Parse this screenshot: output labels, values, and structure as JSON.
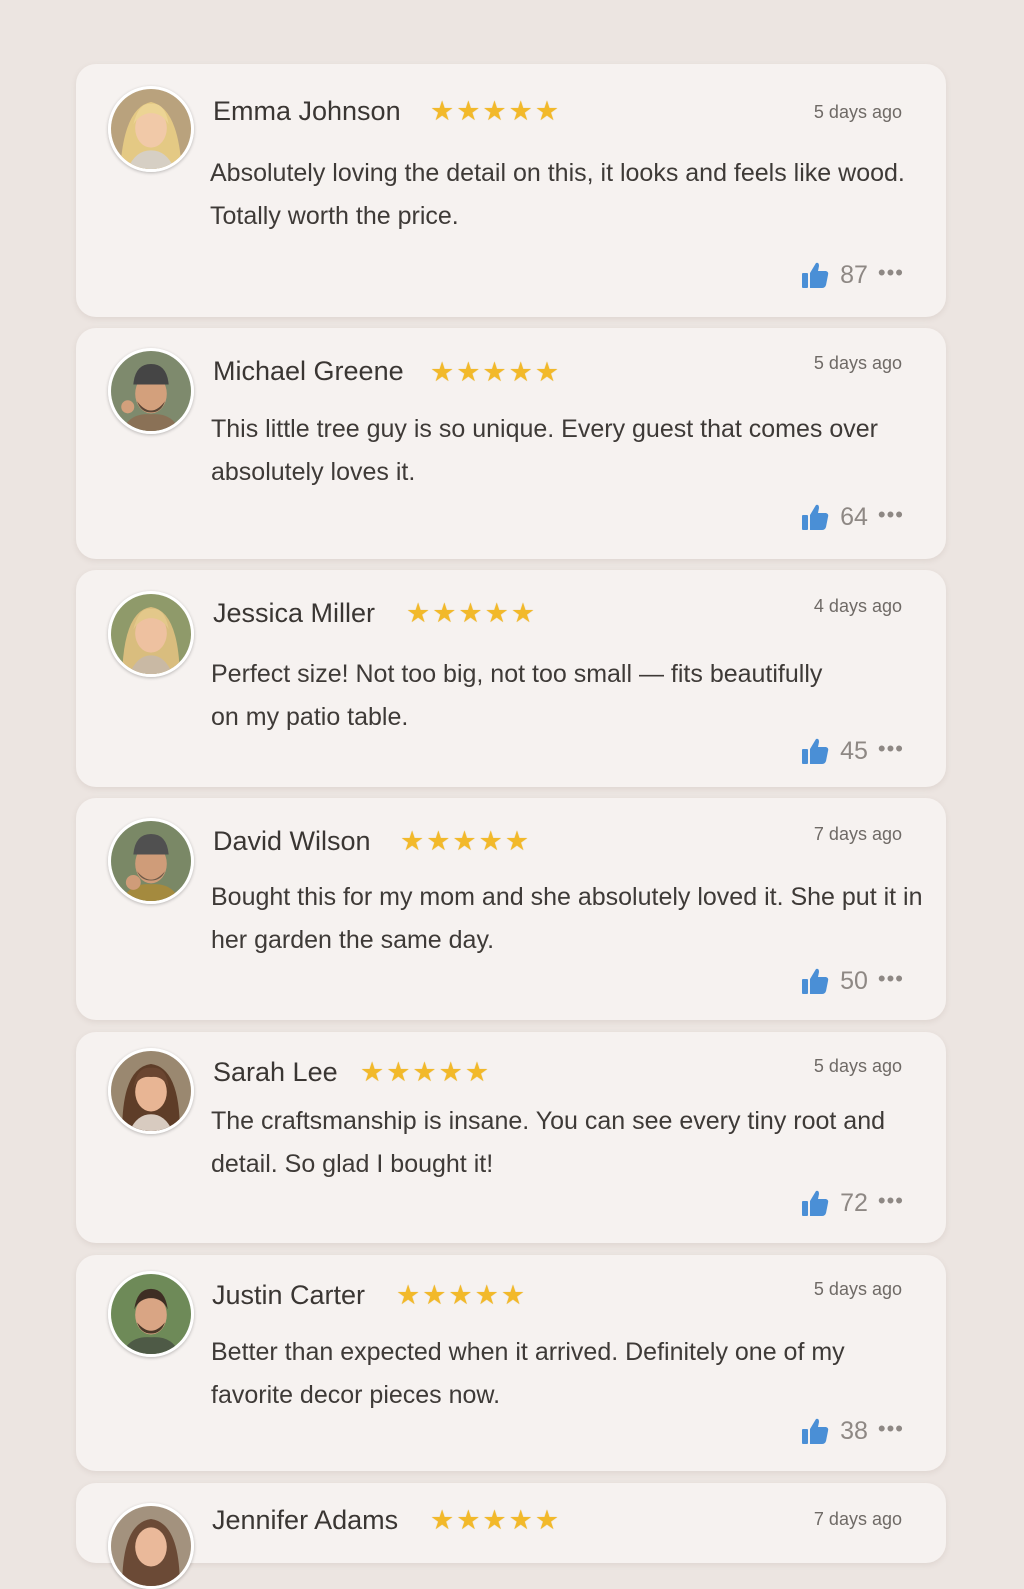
{
  "accent": {
    "star": "#f2b92a",
    "thumb": "#4a8fd6"
  },
  "reviews": [
    {
      "name": "Emma Johnson",
      "stars": "★★★★★",
      "time": "5 days ago",
      "text": "Absolutely loving the detail on this, it looks and feels like wood. Totally worth the price.",
      "likes": "87",
      "more": "•••",
      "rating": 5
    },
    {
      "name": "Michael Greene",
      "stars": "★★★★★",
      "time": "5 days ago",
      "text": "This little tree guy is so unique. Every guest that comes over absolutely loves it.",
      "likes": "64",
      "more": "•••",
      "rating": 5
    },
    {
      "name": "Jessica Miller",
      "stars": "★★★★★",
      "time": "4 days ago",
      "text": "Perfect size! Not too big, not too small — fits beautifully on my patio table.",
      "likes": "45",
      "more": "•••",
      "rating": 5
    },
    {
      "name": "David Wilson",
      "stars": "★★★★★",
      "time": "7 days ago",
      "text": "Bought this for my mom and she absolutely loved it. She put it in her garden the same day.",
      "likes": "50",
      "more": "•••",
      "rating": 5
    },
    {
      "name": "Sarah Lee",
      "stars": "★★★★★",
      "time": "5 days ago",
      "text": "The craftsmanship is insane. You can see every tiny root and detail. So glad I bought it!",
      "likes": "72",
      "more": "•••",
      "rating": 5
    },
    {
      "name": "Justin Carter",
      "stars": "★★★★★",
      "time": "5 days ago",
      "text": "Better than expected when it arrived. Definitely one of my favorite decor pieces now.",
      "likes": "38",
      "more": "•••",
      "rating": 5
    },
    {
      "name": "Jennifer Adams",
      "stars": "★★★★★",
      "time": "7 days ago",
      "rating": 5
    }
  ]
}
